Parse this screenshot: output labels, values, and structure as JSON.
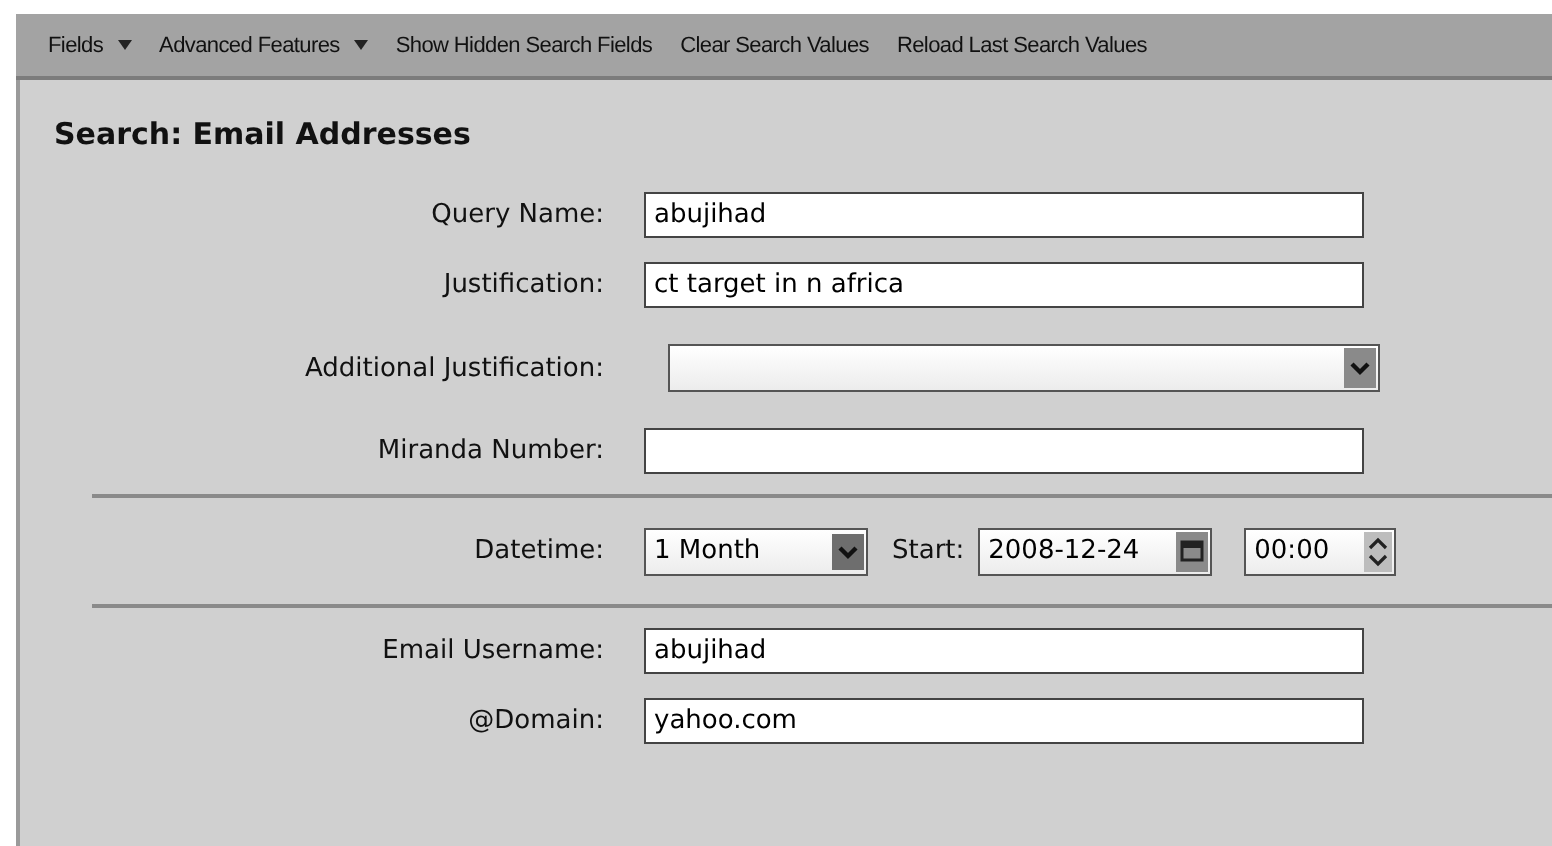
{
  "toolbar": [
    {
      "label": "Fields",
      "kind": "menu"
    },
    {
      "label": "Advanced Features",
      "kind": "menu"
    },
    {
      "label": "Show Hidden Search Fields",
      "kind": "action"
    },
    {
      "label": "Clear Search Values",
      "kind": "action"
    },
    {
      "label": "Reload Last Search Values",
      "kind": "action"
    }
  ],
  "title": "Search: Email Addresses",
  "rows": [
    {
      "kind": "text",
      "label": "Query Name:",
      "value": "abujihad"
    },
    {
      "kind": "text",
      "label": "Justification:",
      "value": "ct target in n africa"
    },
    {
      "kind": "select",
      "label": "Additional Justification:",
      "value": ""
    },
    {
      "kind": "text",
      "label": "Miranda Number:",
      "value": ""
    },
    {
      "kind": "divider"
    },
    {
      "kind": "datetime",
      "label": "Datetime:",
      "range": "1 Month",
      "start_label": "Start:",
      "date": "2008-12-24",
      "time": "00:00"
    },
    {
      "kind": "divider"
    },
    {
      "kind": "text",
      "label": "Email Username:",
      "value": "abujihad"
    },
    {
      "kind": "text",
      "label": "@Domain:",
      "value": "yahoo.com"
    }
  ]
}
